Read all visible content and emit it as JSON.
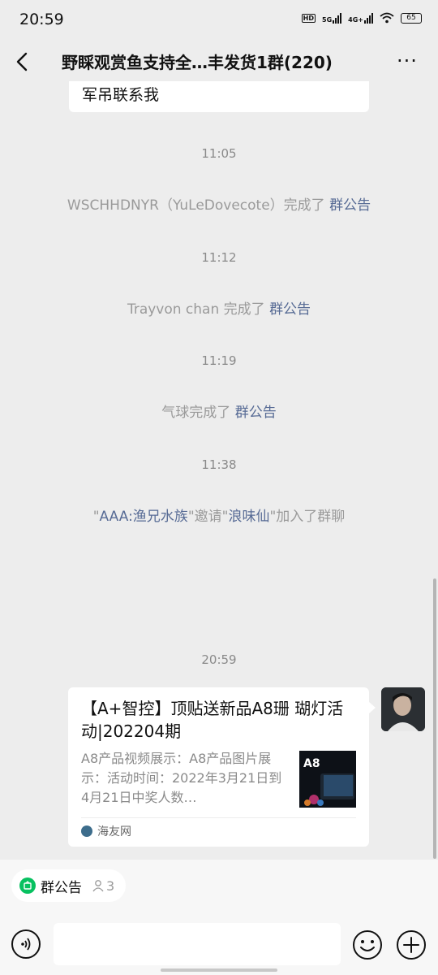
{
  "status_bar": {
    "time": "20:59",
    "hd_label": "HD",
    "network_1": "5G",
    "network_2": "4G+",
    "battery": "65"
  },
  "header": {
    "title": "野睬观赏鱼支持全…丰发货1群(220)",
    "back_icon": "chevron-left-icon",
    "more_icon": "more-horizontal-icon",
    "more_label": "···"
  },
  "chat": {
    "previous_message_fragment": "军吊联系我",
    "events": [
      {
        "time": "11:05",
        "actor": "WSCHHDNYR（YuLeDovecote）",
        "verb": "完成了",
        "link": "群公告"
      },
      {
        "time": "11:12",
        "actor": "Trayvon chan ",
        "verb": "完成了",
        "link": "群公告"
      },
      {
        "time": "11:19",
        "actor": "气球",
        "verb": "完成了",
        "link": "群公告"
      }
    ],
    "invite_event": {
      "time": "11:38",
      "q1": "\"",
      "inviter": "AAA:渔兄水族",
      "q2": "\"邀请\"",
      "invitee": "浪味仙",
      "tail": "\"加入了群聊"
    },
    "card_time": "20:59",
    "article_card": {
      "title": "【A+智控】顶贴送新品A8珊 瑚灯活动|202204期",
      "description": "A8产品视频展示：A8产品图片展示：活动时间：2022年3月21日到4月21日中奖人数…",
      "thumb_label": "A8",
      "source": "海友网"
    }
  },
  "bottom_bar": {
    "notice_label": "群公告",
    "notice_count": "3",
    "input_value": "",
    "input_placeholder": ""
  },
  "colors": {
    "background": "#ededed",
    "link": "#576b95",
    "accent_green": "#07c160",
    "system_text": "#9a9a9a"
  }
}
